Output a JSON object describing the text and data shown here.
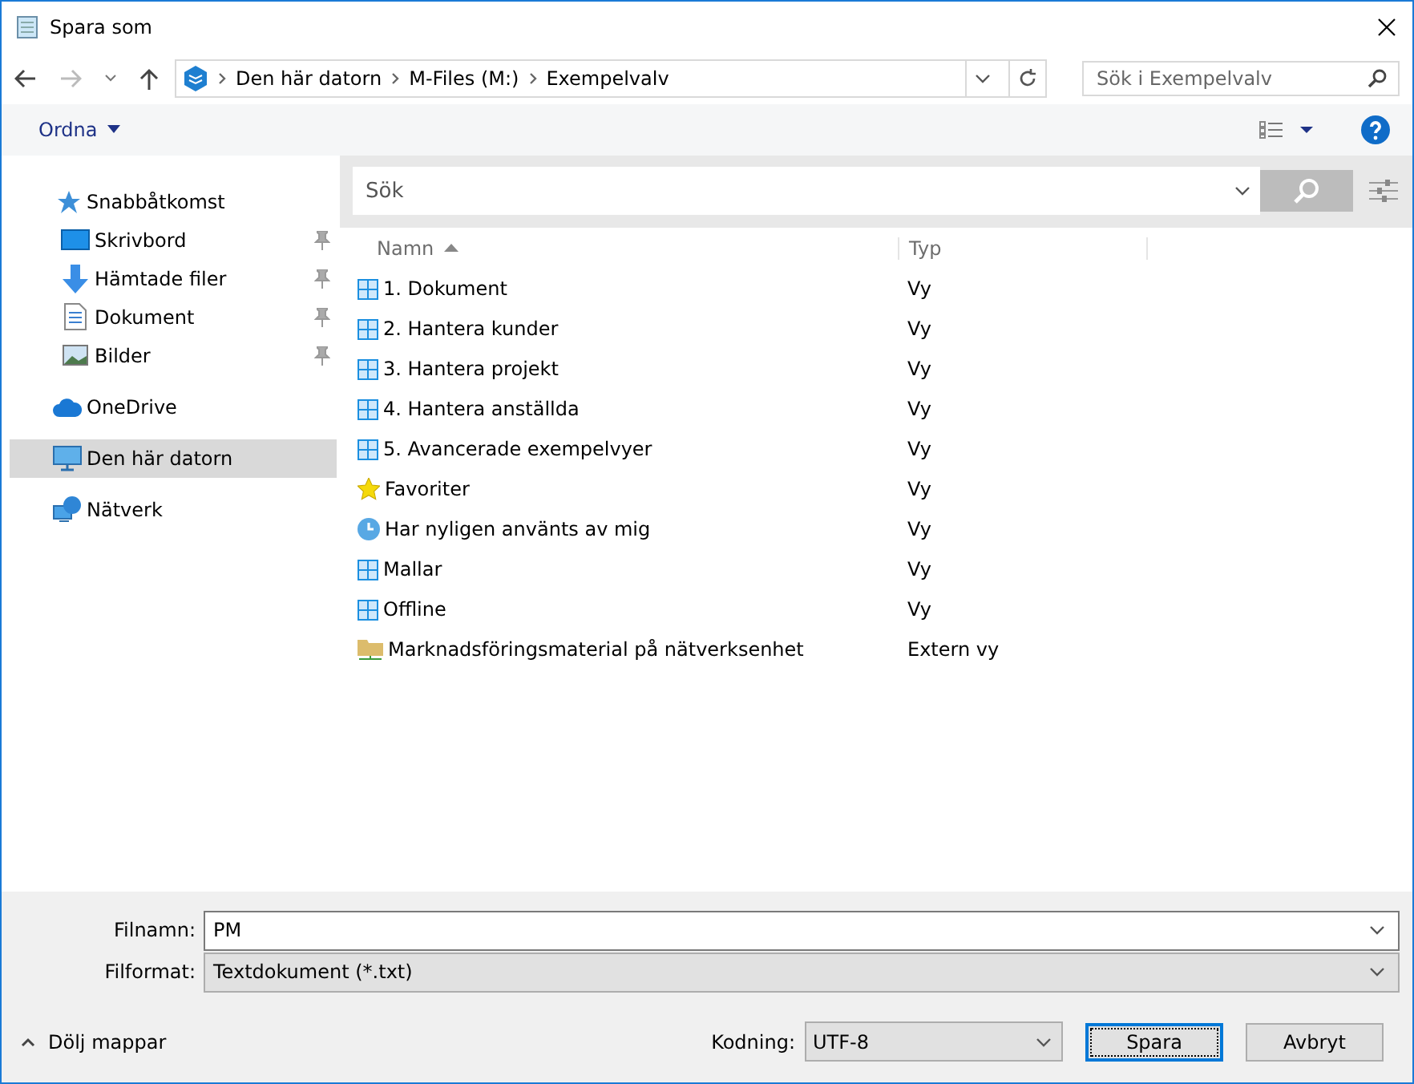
{
  "window": {
    "title": "Spara som"
  },
  "address": {
    "crumbs": [
      "Den här datorn",
      "M-Files (M:)",
      "Exempelvalv"
    ]
  },
  "search": {
    "placeholder": "Sök i Exempelvalv"
  },
  "toolbar": {
    "organize": "Ordna"
  },
  "sidebar": {
    "items": [
      {
        "label": "Snabbåtkomst",
        "kind": "quick",
        "pinned": false,
        "selected": false,
        "children": [
          {
            "label": "Skrivbord",
            "kind": "desktop",
            "pinned": true,
            "selected": false
          },
          {
            "label": "Hämtade filer",
            "kind": "download",
            "pinned": true,
            "selected": false
          },
          {
            "label": "Dokument",
            "kind": "document",
            "pinned": true,
            "selected": false
          },
          {
            "label": "Bilder",
            "kind": "pictures",
            "pinned": true,
            "selected": false
          }
        ]
      },
      {
        "label": "OneDrive",
        "kind": "cloud",
        "pinned": false,
        "selected": false
      },
      {
        "label": "Den här datorn",
        "kind": "computer",
        "pinned": false,
        "selected": true
      },
      {
        "label": "Nätverk",
        "kind": "network",
        "pinned": false,
        "selected": false
      }
    ]
  },
  "content_search": {
    "placeholder": "Sök"
  },
  "table": {
    "columns": [
      "Namn",
      "Typ"
    ],
    "rows": [
      {
        "name": "1. Dokument",
        "type": "Vy",
        "kind": "view"
      },
      {
        "name": "2. Hantera kunder",
        "type": "Vy",
        "kind": "view"
      },
      {
        "name": "3. Hantera projekt",
        "type": "Vy",
        "kind": "view"
      },
      {
        "name": "4. Hantera anställda",
        "type": "Vy",
        "kind": "view"
      },
      {
        "name": "5. Avancerade exempelvyer",
        "type": "Vy",
        "kind": "view"
      },
      {
        "name": "Favoriter",
        "type": "Vy",
        "kind": "star"
      },
      {
        "name": "Har nyligen använts av mig",
        "type": "Vy",
        "kind": "clock"
      },
      {
        "name": "Mallar",
        "type": "Vy",
        "kind": "view"
      },
      {
        "name": "Offline",
        "type": "Vy",
        "kind": "view"
      },
      {
        "name": "Marknadsföringsmaterial på nätverksenhet",
        "type": "Extern vy",
        "kind": "folder"
      }
    ]
  },
  "form": {
    "filename_label": "Filnamn:",
    "filename": "PM",
    "format_label": "Filformat:",
    "format": "Textdokument (*.txt)",
    "encoding_label": "Kodning:",
    "encoding": "UTF-8"
  },
  "buttons": {
    "hide_folders": "Dölj mappar",
    "save": "Spara",
    "cancel": "Avbryt"
  }
}
